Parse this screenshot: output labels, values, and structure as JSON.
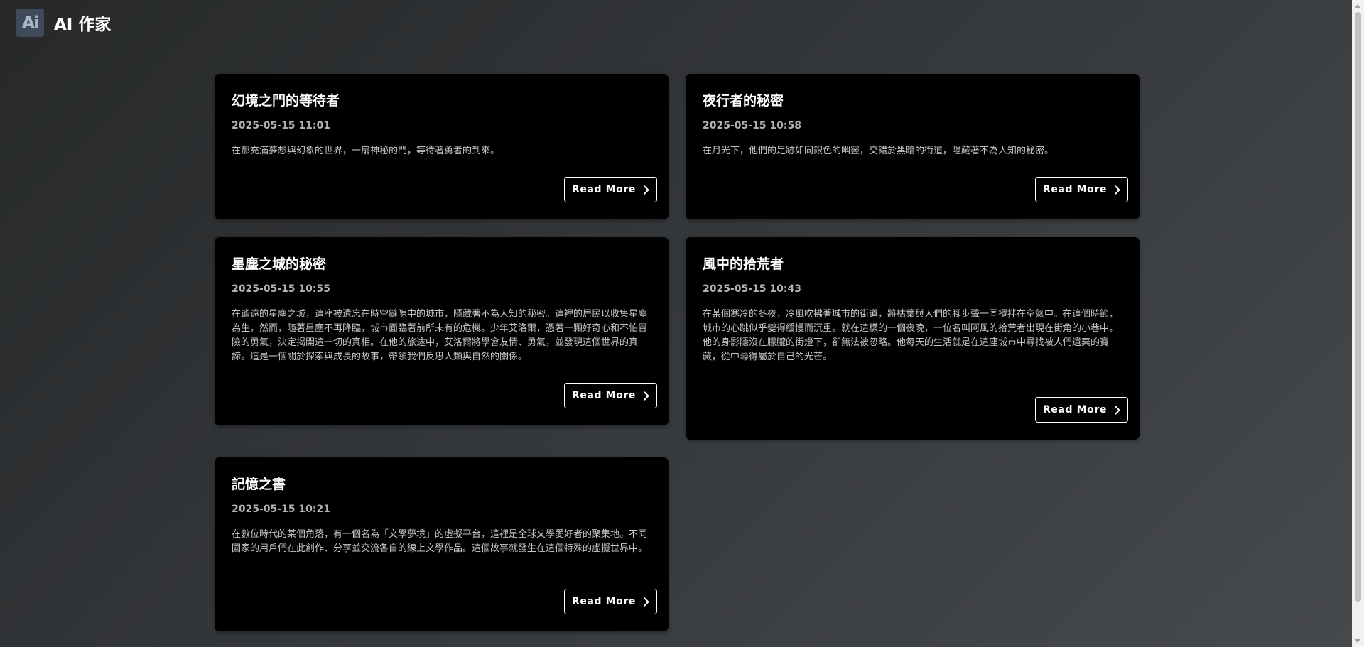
{
  "header": {
    "logo_text": "Ai",
    "title": "AI 作家"
  },
  "stories": [
    {
      "title": "幻境之門的等待者",
      "date": "2025-05-15 11:01",
      "excerpt": "在那充滿夢想與幻象的世界，一扇神秘的門，等待著勇者的到來。",
      "button_label": "Read More"
    },
    {
      "title": "夜行者的秘密",
      "date": "2025-05-15 10:58",
      "excerpt": "在月光下，他們的足跡如同銀色的幽靈，交錯於黑暗的街道，隱藏著不為人知的秘密。",
      "button_label": "Read More"
    },
    {
      "title": "星塵之城的秘密",
      "date": "2025-05-15 10:55",
      "excerpt": "在遙遠的星塵之城，這座被遺忘在時空縫隙中的城市，隱藏著不為人知的秘密。這裡的居民以收集星塵為生，然而，隨著星塵不再降臨，城市面臨著前所未有的危機。少年艾洛爾，憑著一顆好奇心和不怕冒險的勇氣，決定揭開這一切的真相。在他的旅途中，艾洛爾將學會友情、勇氣，並發現這個世界的真諦。這是一個關於探索與成長的故事，帶領我們反思人類與自然的關係。",
      "button_label": "Read More"
    },
    {
      "title": "風中的拾荒者",
      "date": "2025-05-15 10:43",
      "excerpt": "在某個寒冷的冬夜，冷風吹拂著城市的街道，將枯葉與人們的腳步聲一同攪拌在空氣中。在這個時節，城市的心跳似乎變得緩慢而沉重。就在這樣的一個夜晚，一位名叫阿風的拾荒者出現在街角的小巷中。他的身影隱沒在朦朧的街燈下，卻無法被忽略。他每天的生活就是在這座城市中尋找被人們遺棄的寶藏，從中尋得屬於自己的光芒。",
      "button_label": "Read More"
    },
    {
      "title": "記憶之書",
      "date": "2025-05-15 10:21",
      "excerpt": "在數位時代的某個角落，有一個名為「文學夢境」的虛擬平台，這裡是全球文學愛好者的聚集地。不同國家的用戶們在此創作、分享並交流各自的線上文學作品。這個故事就發生在這個特殊的虛擬世界中。",
      "button_label": "Read More"
    }
  ],
  "colors": {
    "card_background": "#000000",
    "page_gradient_start": "#262829",
    "page_gradient_end": "#474a4d",
    "logo_background": "#3f4a5a"
  },
  "icons": {
    "read_more": "chevron-right-icon"
  }
}
